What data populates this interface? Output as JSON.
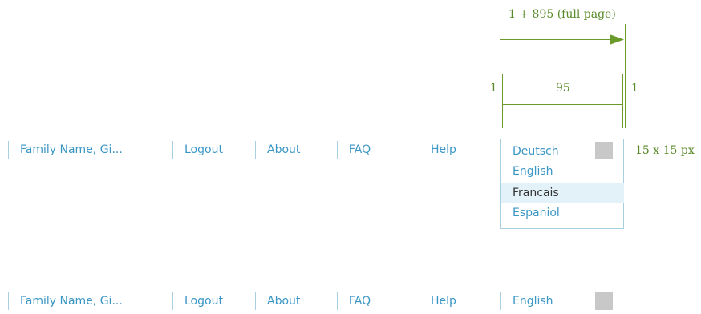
{
  "nav": {
    "items": [
      {
        "label": "Family Name, Gi..."
      },
      {
        "label": "Logout"
      },
      {
        "label": "About"
      },
      {
        "label": "FAQ"
      },
      {
        "label": "Help"
      }
    ]
  },
  "language": {
    "selected": "English",
    "options": [
      "Deutsch",
      "English",
      "Francais",
      "Espaniol"
    ],
    "hovered": "Francais"
  },
  "annotations": {
    "full_page": "1 + 895 (full page)",
    "left_border": "1",
    "inner_width": "95",
    "right_border": "1",
    "square_size": "15 x 15 px"
  },
  "colors": {
    "link": "#3a96c4",
    "separator": "#a8cfe2",
    "hover_bg": "#e3f1f8",
    "annotation": "#5a8a2a",
    "square": "#c8c8c8"
  }
}
